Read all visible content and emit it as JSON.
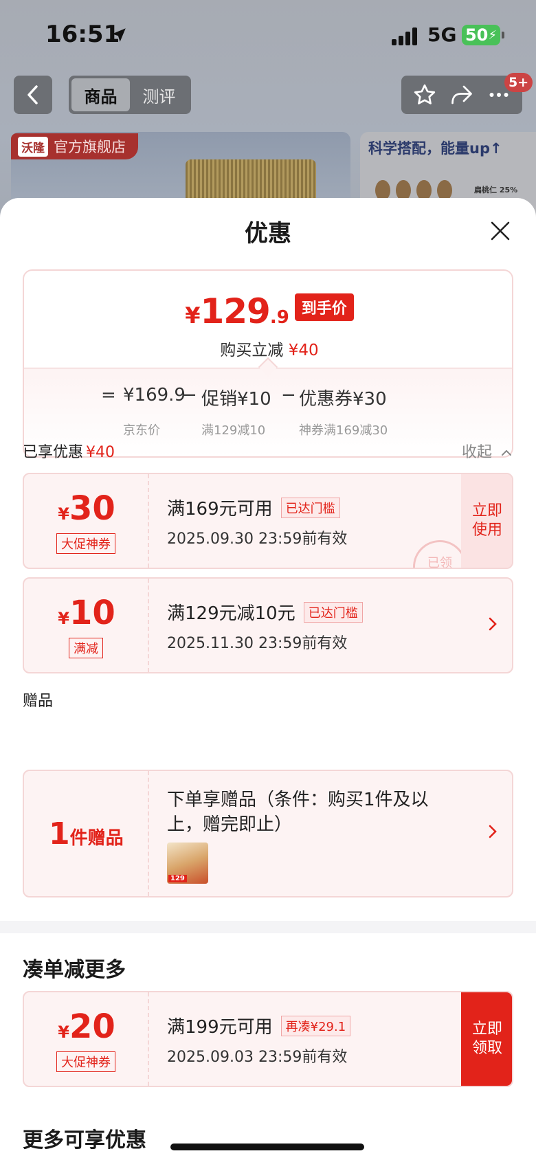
{
  "status": {
    "time": "16:51",
    "network": "5G",
    "battery": "50"
  },
  "nav": {
    "tabs": [
      "商品",
      "测评"
    ],
    "badge": "5+"
  },
  "hero": {
    "brand_logo": "沃隆",
    "store_label": "官方旗舰店",
    "right_title": "科学搭配，能量up↑",
    "right_sub": "扁桃仁 25%"
  },
  "sheet": {
    "title": "优惠",
    "summary": {
      "yen": "¥",
      "price_int": "129",
      "price_dec": ".9",
      "price_tag": "到手价",
      "instant_label": "购买立减",
      "instant_value": "¥40",
      "eq": "=",
      "jd_price": "¥169.9",
      "jd_label": "京东价",
      "minus1": "−",
      "promo": "促销¥10",
      "promo_label": "满129减10",
      "minus2": "−",
      "coupon": "优惠券¥30",
      "coupon_label": "神券满169减30"
    },
    "enjoyed": {
      "label": "已享优惠",
      "value": "¥40",
      "collapse": "收起"
    },
    "coupons": [
      {
        "yen": "¥",
        "amount": "30",
        "type": "大促神券",
        "condition": "满169元可用",
        "flag": "已达门槛",
        "date": "2025.09.30 23:59前有效",
        "action": "立即使用",
        "stamp": "已领"
      },
      {
        "yen": "¥",
        "amount": "10",
        "type": "满减",
        "condition": "满129元减10元",
        "flag": "已达门槛",
        "date": "2025.11.30 23:59前有效"
      }
    ],
    "gift_section": "赠品",
    "gift": {
      "count": "1",
      "unit": "件赠品",
      "text": "下单享赠品（条件：购买1件及以上，赠完即止）",
      "thumb_label": "129"
    },
    "more_deals": {
      "title": "凑单减更多",
      "coupon": {
        "yen": "¥",
        "amount": "20",
        "type": "大促神券",
        "condition": "满199元可用",
        "flag": "再凑¥29.1",
        "date": "2025.09.03 23:59前有效",
        "action": "立即领取"
      }
    },
    "more_title": "更多可享优惠"
  },
  "colors": {
    "accent": "#e2231a",
    "coupon_bg": "#fdf3f3",
    "coupon_border": "#f4d6d6"
  },
  "icons": [
    "location-arrow-icon",
    "back-arrow-icon",
    "star-icon",
    "share-icon",
    "more-icon",
    "close-icon",
    "chevron-right-icon",
    "chevron-up-icon"
  ]
}
